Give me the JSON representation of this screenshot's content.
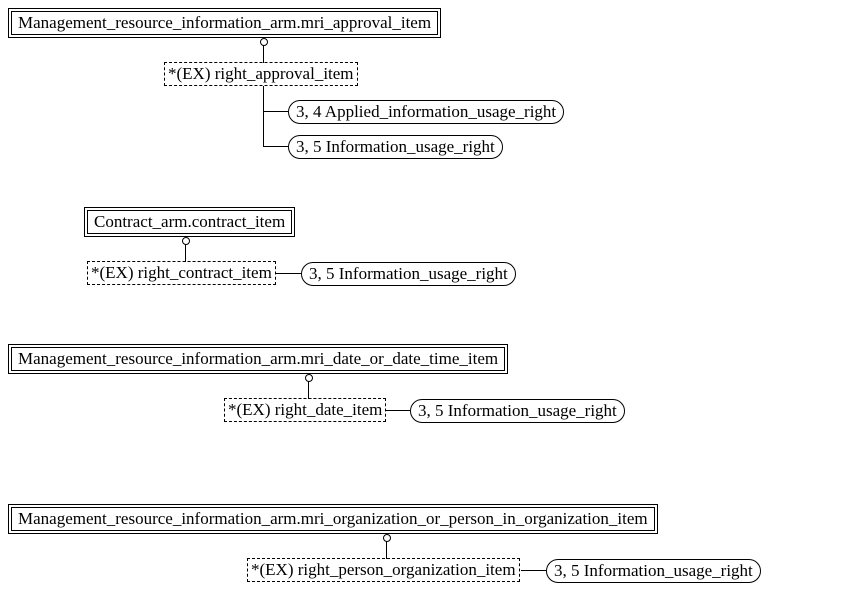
{
  "groups": [
    {
      "parent": "Management_resource_information_arm.mri_approval_item",
      "ex_box": "*(EX) right_approval_item",
      "children": [
        "3, 4 Applied_information_usage_right",
        "3, 5 Information_usage_right"
      ]
    },
    {
      "parent": "Contract_arm.contract_item",
      "ex_box": "*(EX) right_contract_item",
      "children": [
        "3, 5 Information_usage_right"
      ]
    },
    {
      "parent": "Management_resource_information_arm.mri_date_or_date_time_item",
      "ex_box": "*(EX) right_date_item",
      "children": [
        "3, 5 Information_usage_right"
      ]
    },
    {
      "parent": "Management_resource_information_arm.mri_organization_or_person_in_organization_item",
      "ex_box": "*(EX) right_person_organization_item",
      "children": [
        "3, 5 Information_usage_right"
      ]
    }
  ]
}
